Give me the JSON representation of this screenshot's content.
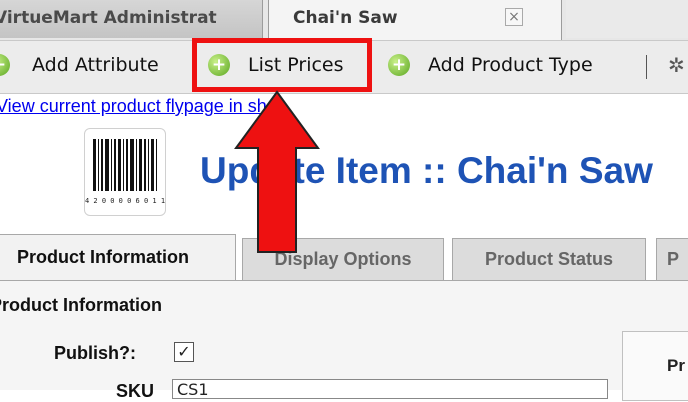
{
  "tabs": [
    {
      "label": "VirtueMart Administrat"
    },
    {
      "label": "Chai'n Saw",
      "close_glyph": "×"
    }
  ],
  "toolbar": {
    "items": [
      {
        "label": "Add Attribute",
        "icon": "add-circle-icon"
      },
      {
        "label": "List Prices",
        "icon": "add-circle-icon"
      },
      {
        "label": "Add Product Type",
        "icon": "add-circle-icon"
      }
    ]
  },
  "link": {
    "text": "View current product flypage in shop"
  },
  "heading": {
    "title": "Update Item :: Chai'n Saw",
    "barcode_digits": "4 2 0 0 0 0 6 0 1 1"
  },
  "section_tabs": [
    {
      "label": "Product Information"
    },
    {
      "label": "Display Options"
    },
    {
      "label": "Product Status"
    },
    {
      "label": "P"
    }
  ],
  "form": {
    "section_title": "Product Information",
    "publish_label": "Publish?:",
    "publish_checked": "✓",
    "sku_label": "SKU",
    "sku_value": "CS1",
    "right_panel_label": "Pr"
  },
  "colors": {
    "highlight": "#ee1111",
    "heading": "#1e53b5",
    "link": "#0000ee",
    "icon_green": "#5aa61f"
  }
}
